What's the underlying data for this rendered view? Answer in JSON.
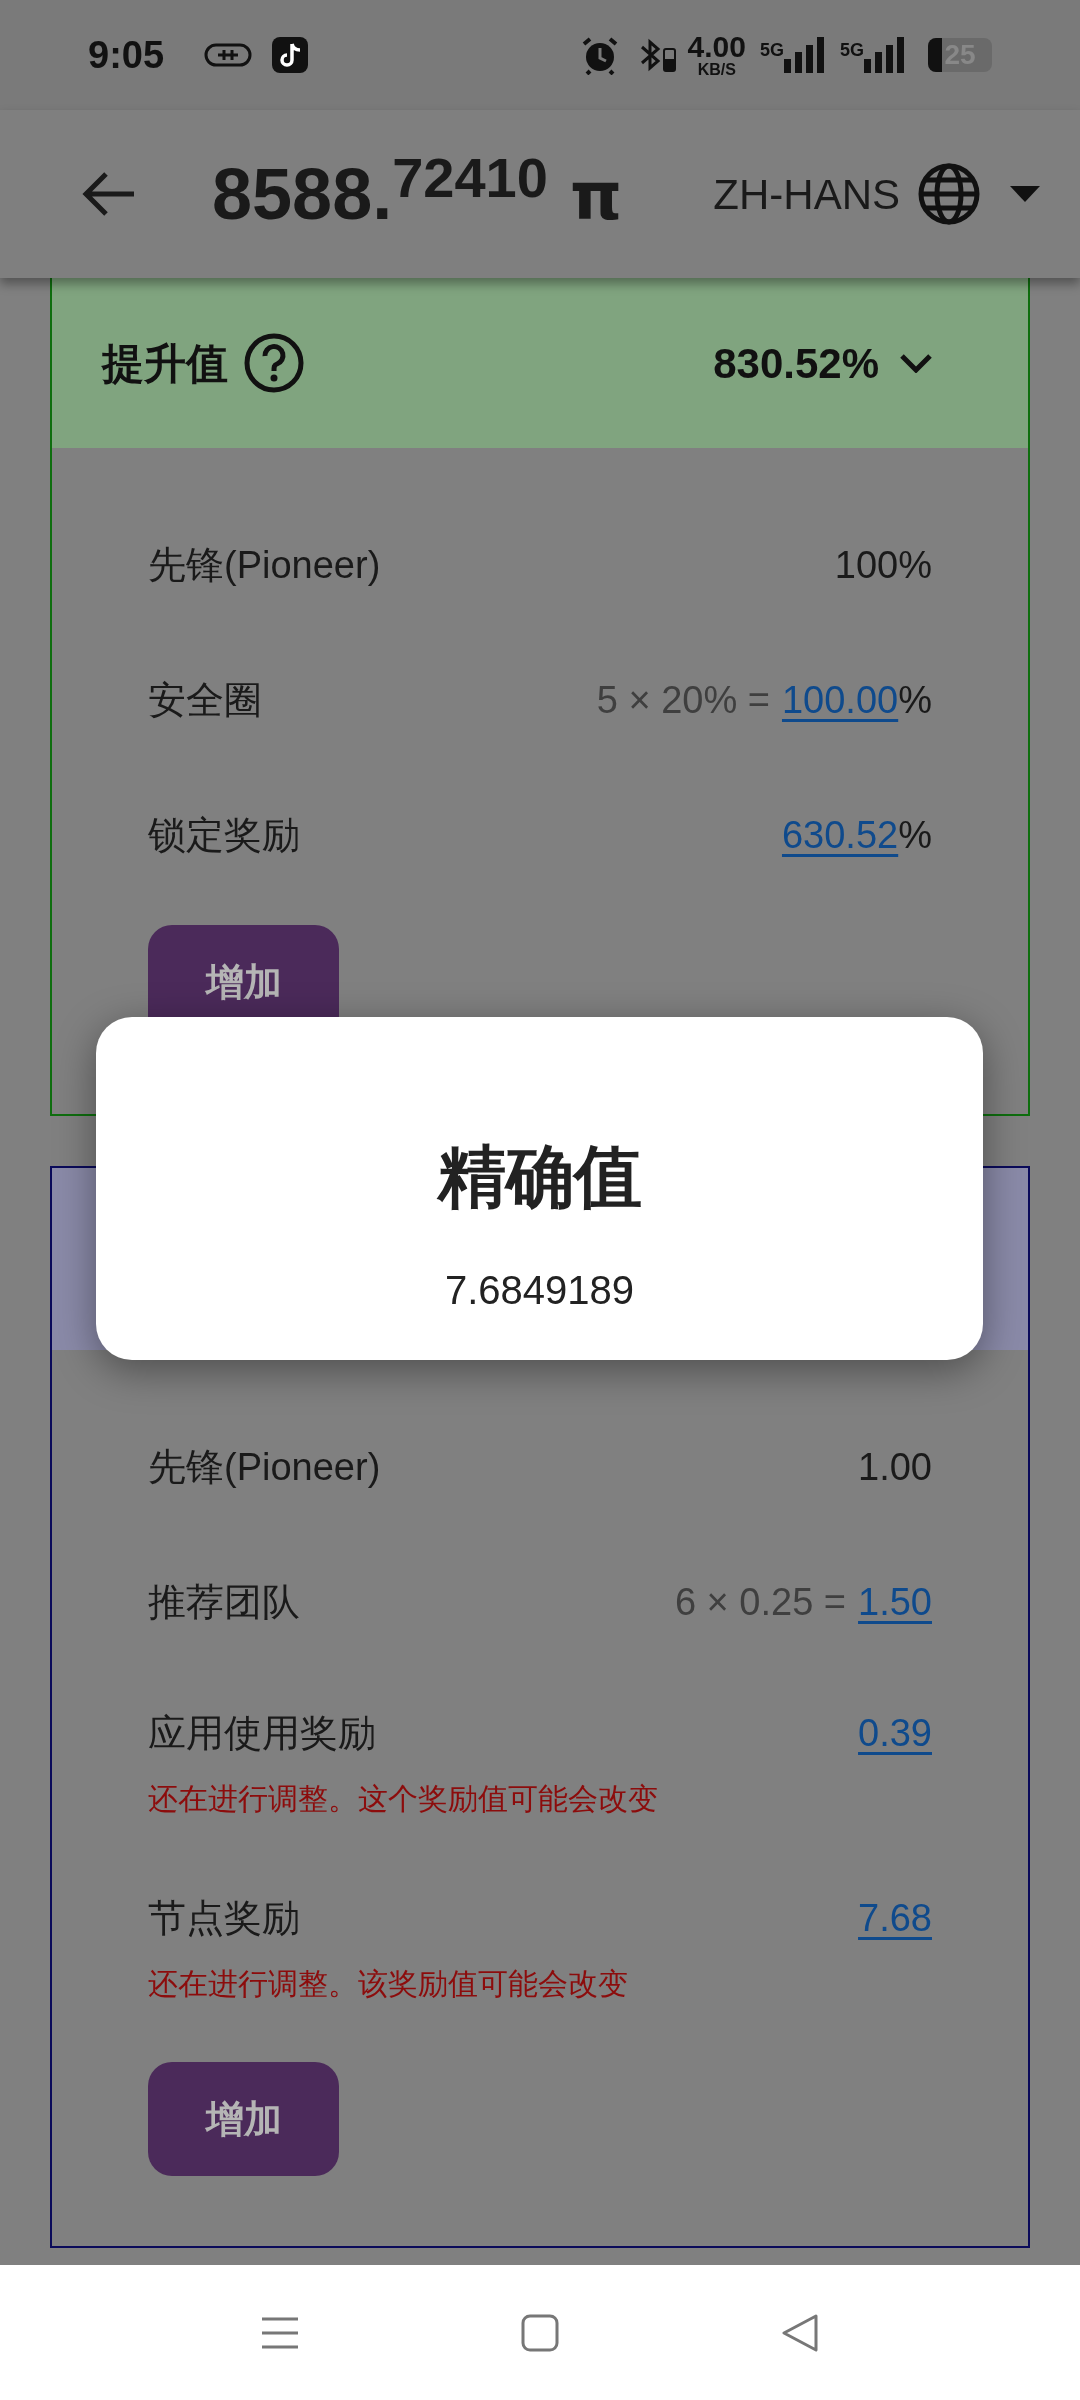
{
  "status_bar": {
    "time": "9:05",
    "speed": "4.00",
    "speed_unit": "KB/S",
    "networks": [
      "5G",
      "5G"
    ],
    "battery": "25"
  },
  "header": {
    "balance_integer": "8588.",
    "balance_fraction": "72410",
    "currency": "π",
    "language": "ZH-HANS"
  },
  "cards": [
    {
      "kind": "boost",
      "title": "提升值",
      "value": "830.52%",
      "rows": [
        {
          "label": "先锋(Pioneer)",
          "value": "100%",
          "linked": false
        },
        {
          "label": "安全圈",
          "formula": "5 × 20% =",
          "value": "100.00",
          "suffix": "%",
          "linked": true
        },
        {
          "label": "锁定奖励",
          "value": "630.52",
          "suffix": "%",
          "linked": true
        }
      ],
      "button": "增加"
    },
    {
      "kind": "rate",
      "rows": [
        {
          "label": "先锋(Pioneer)",
          "value": "1.00",
          "linked": false
        },
        {
          "label": "推荐团队",
          "formula": "6 × 0.25 =",
          "value": "1.50",
          "linked": true
        },
        {
          "label": "应用使用奖励",
          "value": "0.39",
          "linked": true,
          "note": "还在进行调整。这个奖励值可能会改变"
        },
        {
          "label": "节点奖励",
          "value": "7.68",
          "linked": true,
          "note": "还在进行调整。该奖励值可能会改变"
        }
      ],
      "button": "增加"
    }
  ],
  "dialog": {
    "title": "精确值",
    "value": "7.6849189"
  }
}
